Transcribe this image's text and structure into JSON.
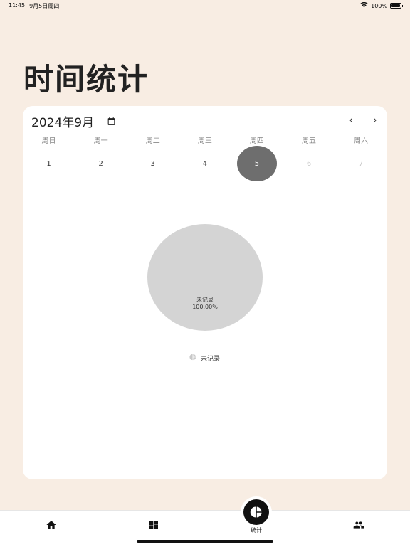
{
  "status": {
    "time": "11:45",
    "date": "9月5日周四",
    "battery": "100%",
    "battery_level": 1.0
  },
  "page": {
    "title": "时间统计"
  },
  "calendar": {
    "month_label": "2024年9月",
    "weekdays": [
      "周日",
      "周一",
      "周二",
      "周三",
      "周四",
      "周五",
      "周六"
    ],
    "dates": [
      "1",
      "2",
      "3",
      "4",
      "5",
      "6",
      "7"
    ],
    "selected": "5"
  },
  "chart_data": {
    "type": "pie",
    "slices": [
      {
        "label": "未记录",
        "value": 100.0,
        "display": "100.00%",
        "color": "#d4d4d4"
      }
    ]
  },
  "legend": {
    "label": "未记录"
  },
  "tabs": {
    "stats_label": "统计"
  },
  "colors": {
    "background": "#f8ede3",
    "card": "#ffffff",
    "selected": "#6e6e6e",
    "pie": "#d4d4d4",
    "active_tab": "#111111"
  }
}
